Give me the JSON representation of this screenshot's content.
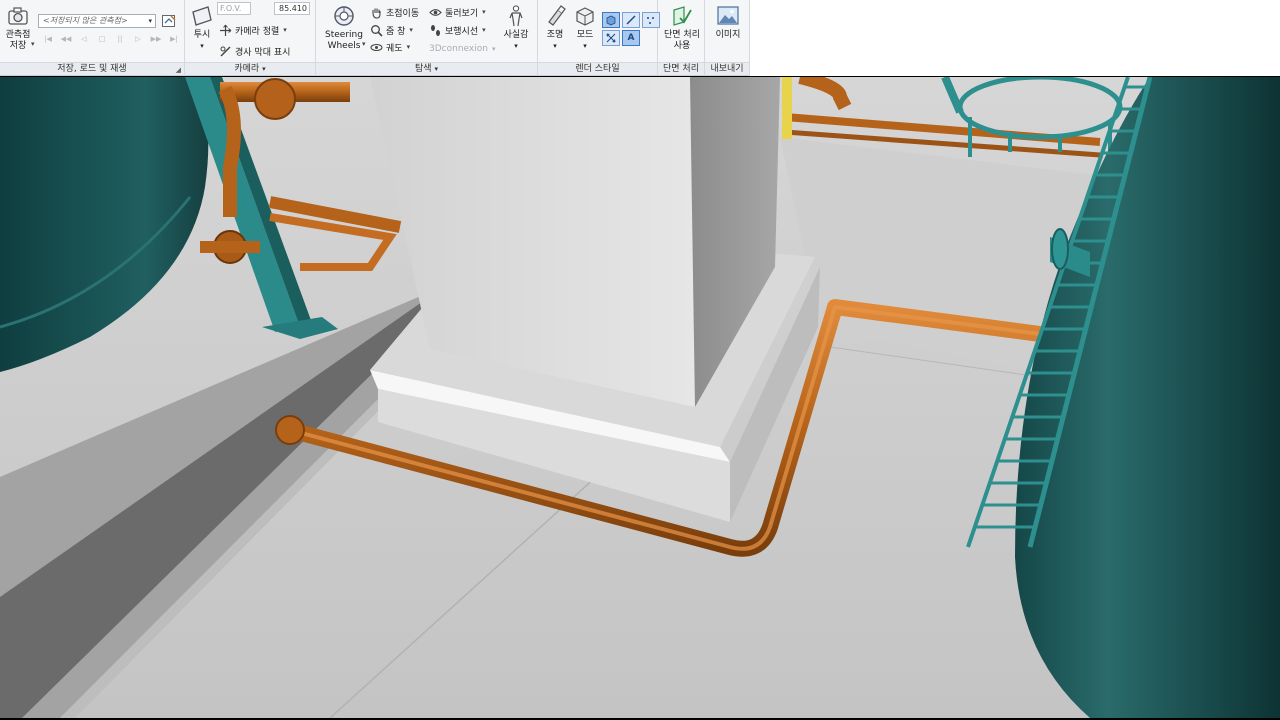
{
  "ribbon": {
    "groups": {
      "save_load": {
        "title": "저장, 로드 및 재생",
        "save_viewpoint_label": "관측점\n저장",
        "save_viewpoint_line1": "관측점",
        "save_viewpoint_line2": "저장",
        "viewpoint_select_value": "<저장되지 않은 관측점>"
      },
      "camera": {
        "title": "카메라",
        "perspective_label": "투시",
        "fov_label": "F.O.V.",
        "fov_value": "85.410",
        "align_camera_label": "카메라 정렬",
        "show_tilt_bar_label": "경사 막대 표시"
      },
      "navigate": {
        "title": "탐색",
        "steering_wheels_line1": "Steering",
        "steering_wheels_line2": "Wheels",
        "pan_label": "초점이동",
        "zoom_label": "줌 창",
        "orbit_label": "궤도",
        "look_around_label": "둘러보기",
        "walk_label": "보행시선",
        "connexion_label": "3Dconnexion",
        "realism_label": "사실감"
      },
      "render_style": {
        "title": "렌더 스타일",
        "lighting_label": "조명",
        "mode_label": "모드",
        "tile_a_label": "A"
      },
      "sectioning": {
        "title": "단면 처리",
        "enable_line1": "단면 처리",
        "enable_line2": "사용"
      },
      "export": {
        "title": "내보내기",
        "image_label": "이미지"
      }
    }
  },
  "icons": {
    "camera": "camera-icon",
    "perspective": "perspective-icon",
    "steering": "steering-wheel-icon",
    "pan": "hand-icon",
    "zoom": "magnifier-icon",
    "orbit": "orbit-icon",
    "look": "eye-icon",
    "walk": "footprints-icon",
    "realism": "person-icon",
    "lighting": "flashlight-icon",
    "mode": "cube-icon",
    "section": "section-plane-icon",
    "image": "image-icon"
  },
  "colors": {
    "tank": "#1f5b5b",
    "pipe": "#b5631a",
    "steel": "#2e8f8f",
    "floor": "#c6c6c6",
    "column": "#d9d9d9"
  }
}
